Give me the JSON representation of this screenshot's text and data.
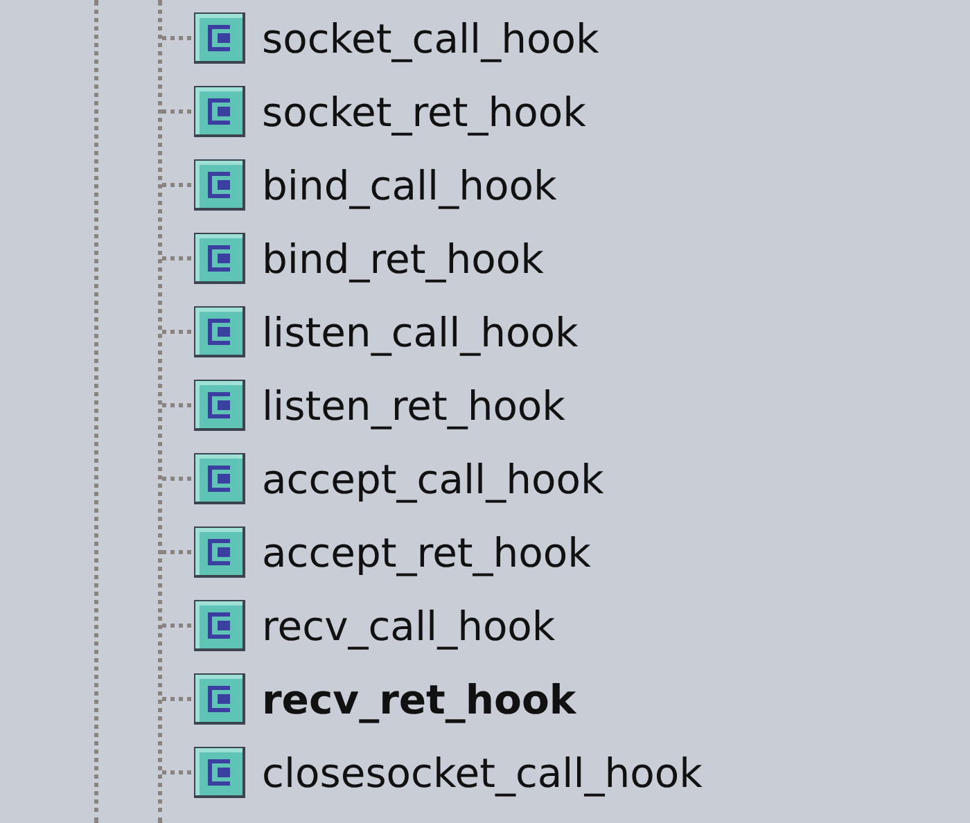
{
  "tree": {
    "items": [
      {
        "label": "socket_call_hook",
        "bold": false
      },
      {
        "label": "socket_ret_hook",
        "bold": false
      },
      {
        "label": "bind_call_hook",
        "bold": false
      },
      {
        "label": "bind_ret_hook",
        "bold": false
      },
      {
        "label": "listen_call_hook",
        "bold": false
      },
      {
        "label": "listen_ret_hook",
        "bold": false
      },
      {
        "label": "accept_call_hook",
        "bold": false
      },
      {
        "label": "accept_ret_hook",
        "bold": false
      },
      {
        "label": "recv_call_hook",
        "bold": false
      },
      {
        "label": "recv_ret_hook",
        "bold": true
      },
      {
        "label": "closesocket_call_hook",
        "bold": false
      }
    ]
  }
}
